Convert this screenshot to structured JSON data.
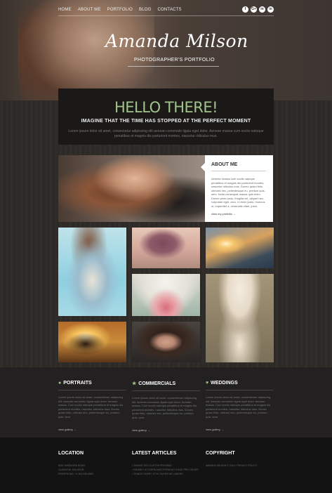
{
  "nav": {
    "items": [
      "HOME",
      "ABOUT ME",
      "PORTFOLIO",
      "BLOG",
      "CONTACTS"
    ]
  },
  "social": [
    "f",
    "G+",
    "in",
    "in"
  ],
  "header": {
    "title": "Amanda Milson",
    "subtitle": "PHOTOGRAPHER'S PORTFOLIO"
  },
  "intro": {
    "headline": "HELLO THERE!",
    "tagline": "IMAGINE THAT THE TIME HAS STOPPED AT THE PERFECT MOMENT",
    "text": "Lorem ipsum dolor sit amet, consectetur adipiscing elit aenean commodo ligula eget dolor. Aenean massa cum sociis natoque penatibus et magnis dis parturient montes, nascetur ridiculus mus."
  },
  "about": {
    "heading": "ABOUT ME",
    "text": "Aenean massa cum sociis natoque penatibus et magnis dis parturient montes, nascetur ridiculus mus. Donec quam felis, ultricies nec, pellentesque eu, pretium quis, sem. Nulla consequat massa quis enim. Donec pede justo, fringilla vel, aliquet nec, vulputate eget, arcu. In enim justo, rhoncus ut, imperdiet a, venenatis vitae, justo.",
    "link": "view my portfolio →"
  },
  "categories": [
    {
      "title": "PORTRAITS",
      "icon": "person-icon",
      "text": "Lorem ipsum dolor sit amet, consectetuer adipiscing elit. Aenean commodo ligula eget dolor. Aenean massa. Cum sociis natoque penatibus et magnis dis parturient montes, nascetur ridiculus mus. Donec quam felis, ultricies nec, pellentesque eu, pretium quis, sem.",
      "link": "view gallery →"
    },
    {
      "title": "COMMERCIALS",
      "icon": "star-icon",
      "text": "Lorem ipsum dolor sit amet, consectetuer adipiscing elit. Aenean commodo ligula eget dolor. Aenean massa. Cum sociis natoque penatibus et magnis dis parturient montes, nascetur ridiculus mus. Donec quam felis, ultricies nec, pellentesque eu, pretium quis, sem.",
      "link": "view gallery →"
    },
    {
      "title": "WEDDINGS",
      "icon": "heart-icon",
      "text": "Lorem ipsum dolor sit amet, consectetuer adipiscing elit. Aenean commodo ligula eget dolor. Aenean massa. Cum sociis natoque penatibus et magnis dis parturient montes, nascetur ridiculus mus. Donec quam felis, ultricies nec, pellentesque eu, pretium quis, sem.",
      "link": "view gallery →"
    }
  ],
  "footer": {
    "location": {
      "title": "LOCATION",
      "lines": [
        "8901 MARMORA ROAD,",
        "GLASGOW, D04 89GR.",
        "FREEPHONE: +1 800 559 6580"
      ]
    },
    "articles": {
      "title": "LATEST ARTICLES",
      "lines": [
        "• SUMMIT DEL CUSTOS PROXIMO",
        "• RHONEY IE CORTA MISCITERM NO GOOD PRO ODORT",
        "• TRINOS ODERT STYE SUPER DE LABORS"
      ]
    },
    "copyright": {
      "title": "COPYRIGHT",
      "lines": [
        "AMANDA MILSON © 2014 | PRIVACY POLICY"
      ]
    }
  },
  "colors": {
    "accent": "#a2c48a",
    "dark": "#1b1918"
  }
}
